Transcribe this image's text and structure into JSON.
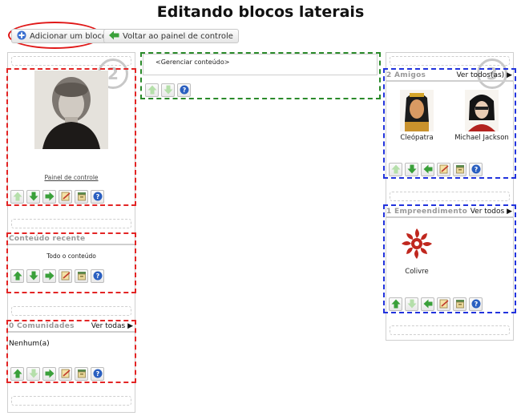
{
  "page": {
    "title": "Editando blocos laterais"
  },
  "toolbar": {
    "add_block": "Adicionar um bloco",
    "back_panel": "Voltar ao painel de controle"
  },
  "center": {
    "manage_content": "<Gerenciar conteúdo>"
  },
  "left": {
    "badge": "2",
    "profile": {
      "link": "Painel de controle"
    },
    "recent": {
      "title": "Conteúdo recente",
      "all_content": "Todo o conteúdo"
    },
    "communities": {
      "title": "0 Comunidades",
      "see_all": "Ver todas",
      "empty": "Nenhum(a)"
    }
  },
  "right": {
    "badge": "3",
    "friends": {
      "title": "2 Amigos",
      "see_all": "Ver todos(as)",
      "items": [
        {
          "name": "Cleópatra"
        },
        {
          "name": "Michael Jackson"
        }
      ]
    },
    "enterprises": {
      "title": "1 Empreendimento",
      "see_all": "Ver todos",
      "items": [
        {
          "name": "Colivre"
        }
      ]
    }
  }
}
